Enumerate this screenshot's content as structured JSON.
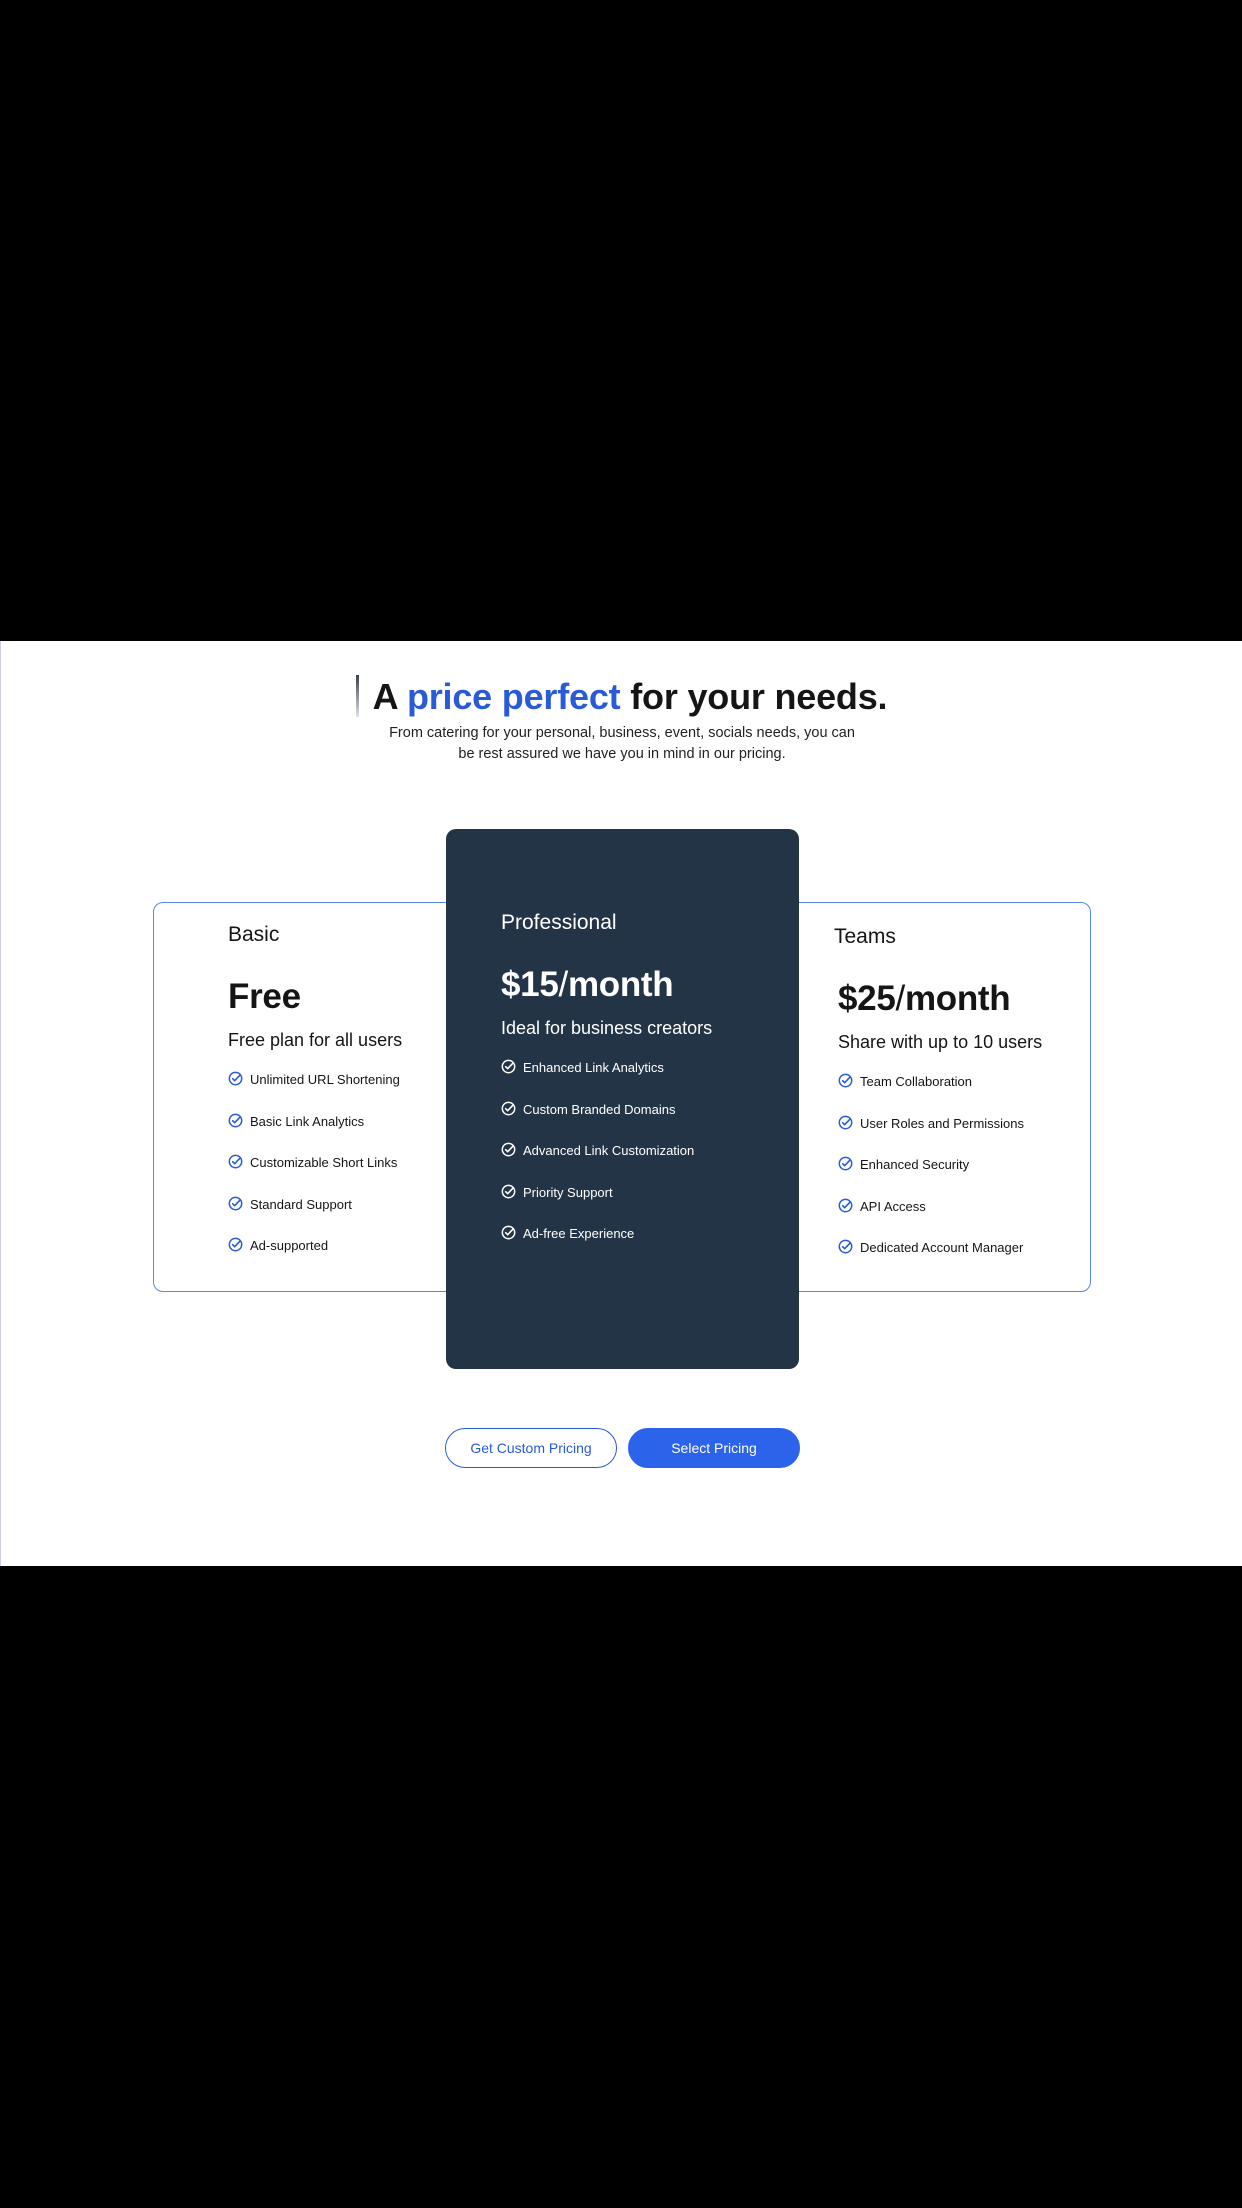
{
  "heading": {
    "prefix": "A",
    "accent": "price perfect",
    "suffix": "for your needs.",
    "subtitle": "From catering for your personal, business, event, socials needs, you can be rest assured we have you in mind in our pricing."
  },
  "plans": [
    {
      "name": "Basic",
      "price": "Free",
      "description": "Free plan for all users",
      "features": [
        "Unlimited URL Shortening",
        "Basic Link Analytics",
        "Customizable Short Links",
        "Standard Support",
        "Ad-supported"
      ]
    },
    {
      "name": "Professional",
      "price_amount": "$15",
      "price_sep": "/",
      "price_period": "month",
      "description": "Ideal for business creators",
      "features": [
        "Enhanced Link Analytics",
        "Custom Branded Domains",
        "Advanced Link Customization",
        "Priority Support",
        "Ad-free Experience"
      ]
    },
    {
      "name": "Teams",
      "price_amount": "$25",
      "price_sep": "/",
      "price_period": "month",
      "description": "Share with up to 10 users",
      "features": [
        "Team Collaboration",
        "User Roles and Permissions",
        "Enhanced Security",
        "API Access",
        "Dedicated Account Manager"
      ]
    }
  ],
  "buttons": {
    "custom_pricing": "Get Custom Pricing",
    "select_pricing": "Select Pricing"
  },
  "colors": {
    "accent": "#2a5bd7",
    "button_primary": "#2c63eb",
    "featured_card": "#243447",
    "check_icon": "check-circle-icon"
  }
}
